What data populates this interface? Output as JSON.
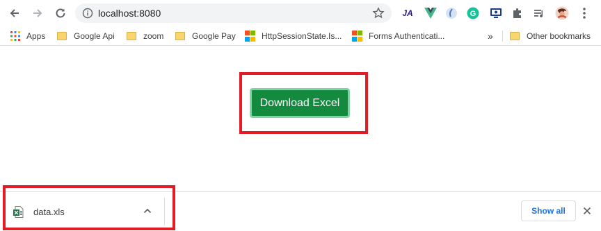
{
  "toolbar": {
    "back_icon": "back-arrow-icon",
    "forward_icon": "forward-arrow-icon",
    "reload_icon": "reload-icon",
    "url": "localhost:8080",
    "extensions": [
      {
        "name": "ja-extension-icon",
        "glyph": "JA",
        "color": "#2b1a80"
      },
      {
        "name": "vue-devtools-icon",
        "glyph": "V",
        "color": "#41b883"
      },
      {
        "name": "extension-drop-icon",
        "glyph": "",
        "color": "#7aa7d8"
      },
      {
        "name": "grammarly-icon",
        "glyph": "G",
        "color": "#15c39a"
      },
      {
        "name": "screen-extension-icon",
        "glyph": "",
        "color": "#1a3b8c"
      },
      {
        "name": "extensions-puzzle-icon",
        "glyph": "",
        "color": "#5f6368"
      },
      {
        "name": "media-queue-icon",
        "glyph": "",
        "color": "#5f6368"
      },
      {
        "name": "profile-avatar",
        "glyph": "",
        "color": "#c8553d"
      },
      {
        "name": "menu-kebab-icon",
        "glyph": "",
        "color": "#5f6368"
      }
    ]
  },
  "bookmarks": {
    "items": [
      {
        "label": "Apps",
        "icon": "apps-grid-icon"
      },
      {
        "label": "Google Api",
        "icon": "folder-icon"
      },
      {
        "label": "zoom",
        "icon": "folder-icon"
      },
      {
        "label": "Google Pay",
        "icon": "folder-icon"
      },
      {
        "label": "HttpSessionState.Is...",
        "icon": "microsoft-logo-icon"
      },
      {
        "label": "Forms Authenticati...",
        "icon": "microsoft-logo-icon"
      }
    ],
    "overflow": "»",
    "other": "Other bookmarks"
  },
  "main": {
    "download_button": "Download Excel"
  },
  "download_shelf": {
    "file_name": "data.xls",
    "show_all": "Show all"
  },
  "colors": {
    "highlight_red": "#e21b24",
    "button_green": "#138a3e",
    "link_blue": "#1a73e8"
  }
}
